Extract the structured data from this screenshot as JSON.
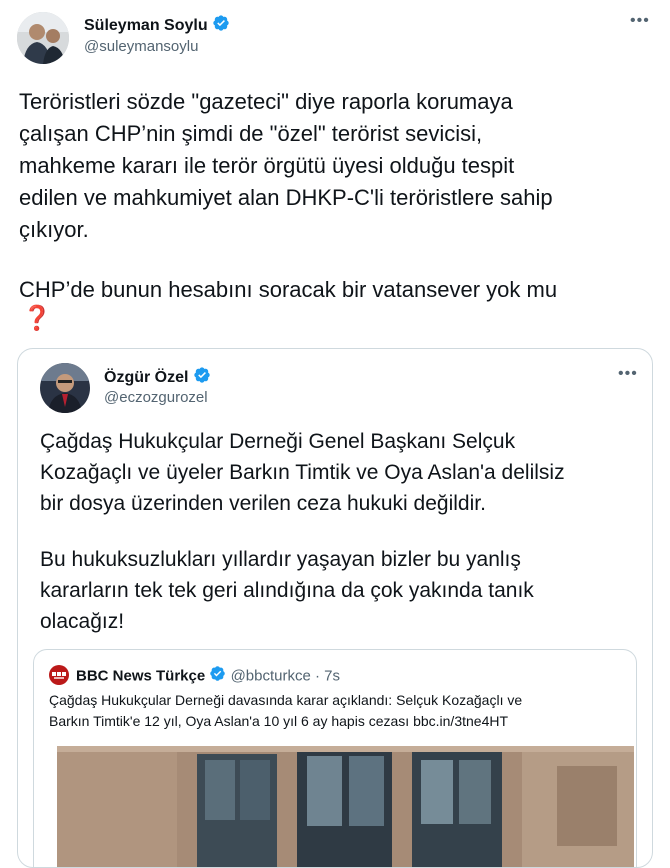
{
  "main_tweet": {
    "author_name": "Süleyman Soylu",
    "author_handle": "@suleymansoylu",
    "more_icon": "more-horizontal-icon",
    "paragraph1": "Teröristleri sözde \"gazeteci\" diye raporla korumaya\nçalışan CHP’nin şimdi de \"özel\" terörist sevicisi,\nmahkeme kararı ile terör örgütü üyesi olduğu tespit\nedilen ve mahkumiyet alan DHKP-C'li teröristlere sahip\nçıkıyor.",
    "paragraph2": "CHP’de bunun hesabını soracak bir vatansever yok mu",
    "emoji": "❓"
  },
  "quoted_tweet": {
    "author_name": "Özgür Özel",
    "author_handle": "@eczozgurozel",
    "paragraph1": "Çağdaş Hukukçular Derneği Genel Başkanı Selçuk\nKozağaçlı ve üyeler Barkın Timtik ve Oya Aslan'a delilsiz\nbir dosya üzerinden verilen ceza hukuki değildir.",
    "paragraph2": "Bu hukuksuzlukları yıllardır yaşayan bizler bu yanlış\nkararların tek tek geri alındığına da çok yakında tanık\nolacağız!"
  },
  "nested_quote": {
    "author_name": "BBC News Türkçe",
    "author_handle": "@bbcturkce",
    "separator": "·",
    "time": "7s",
    "text_line1": "Çağdaş Hukukçular Derneği davasında karar açıklandı: Selçuk Kozağaçlı ve",
    "text_line2": "Barkın Timtik'e 12 yıl, Oya Aslan'a 10 yıl 6 ay hapis cezası bbc.in/3tne4HT"
  },
  "colors": {
    "verified_blue": "#1d9bf0",
    "text": "#0f1419",
    "secondary": "#536471",
    "border": "#cfd9de",
    "emoji_red": "#dd2e44",
    "bbc_red": "#bb1919"
  }
}
